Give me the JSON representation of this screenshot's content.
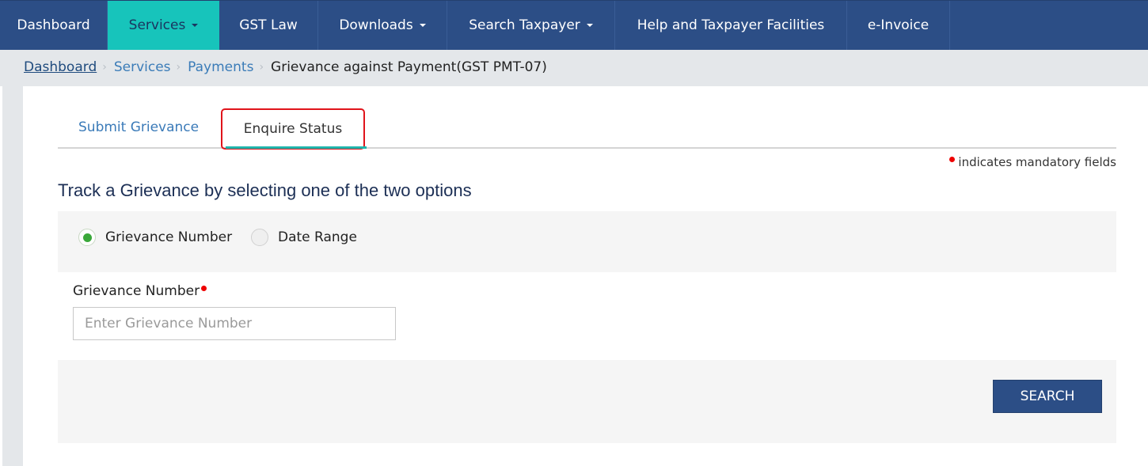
{
  "nav": {
    "items": [
      {
        "label": "Dashboard",
        "dropdown": false,
        "active": false
      },
      {
        "label": "Services",
        "dropdown": true,
        "active": true
      },
      {
        "label": "GST Law",
        "dropdown": false,
        "active": false
      },
      {
        "label": "Downloads",
        "dropdown": true,
        "active": false
      },
      {
        "label": "Search Taxpayer",
        "dropdown": true,
        "active": false
      },
      {
        "label": "Help and Taxpayer Facilities",
        "dropdown": false,
        "active": false
      },
      {
        "label": "e-Invoice",
        "dropdown": false,
        "active": false
      }
    ]
  },
  "breadcrumb": {
    "items": [
      "Dashboard",
      "Services",
      "Payments"
    ],
    "current": "Grievance against Payment(GST PMT-07)"
  },
  "tabs": {
    "submit": "Submit Grievance",
    "enquire": "Enquire Status",
    "active": "Enquire Status"
  },
  "mandatory_note": "indicates mandatory fields",
  "heading": "Track a Grievance by selecting one of the two options",
  "options": {
    "grievance_number": "Grievance Number",
    "date_range": "Date Range",
    "selected": "Grievance Number"
  },
  "field": {
    "label": "Grievance Number",
    "placeholder": "Enter Grievance Number",
    "value": ""
  },
  "actions": {
    "search": "SEARCH"
  },
  "colors": {
    "nav_bg": "#2c4e86",
    "nav_active": "#17c4bb",
    "link": "#3b7cb8",
    "mandatory": "#ee0000",
    "radio_checked": "#3aa83a",
    "highlight_box": "#e0141b"
  }
}
